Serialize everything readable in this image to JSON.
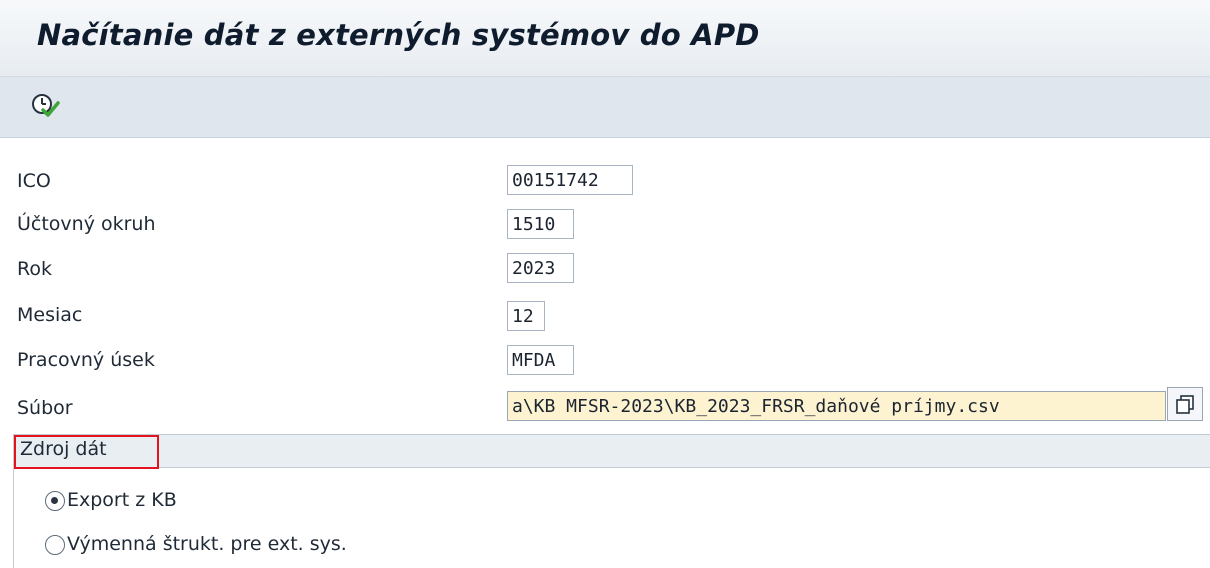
{
  "window": {
    "title": "Načítanie dát z externých systémov do APD"
  },
  "toolbar": {
    "execute_icon": "execute-clock-check-icon"
  },
  "form": {
    "fields": [
      {
        "label": "ICO",
        "value": "00151742"
      },
      {
        "label": "Účtovný okruh",
        "value": "1510"
      },
      {
        "label": "Rok",
        "value": "2023"
      },
      {
        "label": "Mesiac",
        "value": "12"
      },
      {
        "label": "Pracovný úsek",
        "value": "MFDA"
      },
      {
        "label": "Súbor",
        "value": "a\\KB MFSR-2023\\KB_2023_FRSR_daňové príjmy.csv"
      }
    ]
  },
  "data_source": {
    "title": "Zdroj dát",
    "options": [
      {
        "label": "Export z KB",
        "selected": true
      },
      {
        "label": "Výmenná štrukt. pre ext. sys.",
        "selected": false
      }
    ]
  },
  "colors": {
    "required_field_bg": "#fdf3d0",
    "highlight_border": "#e3141e",
    "toolbar_bg": "#dfe6ee"
  }
}
